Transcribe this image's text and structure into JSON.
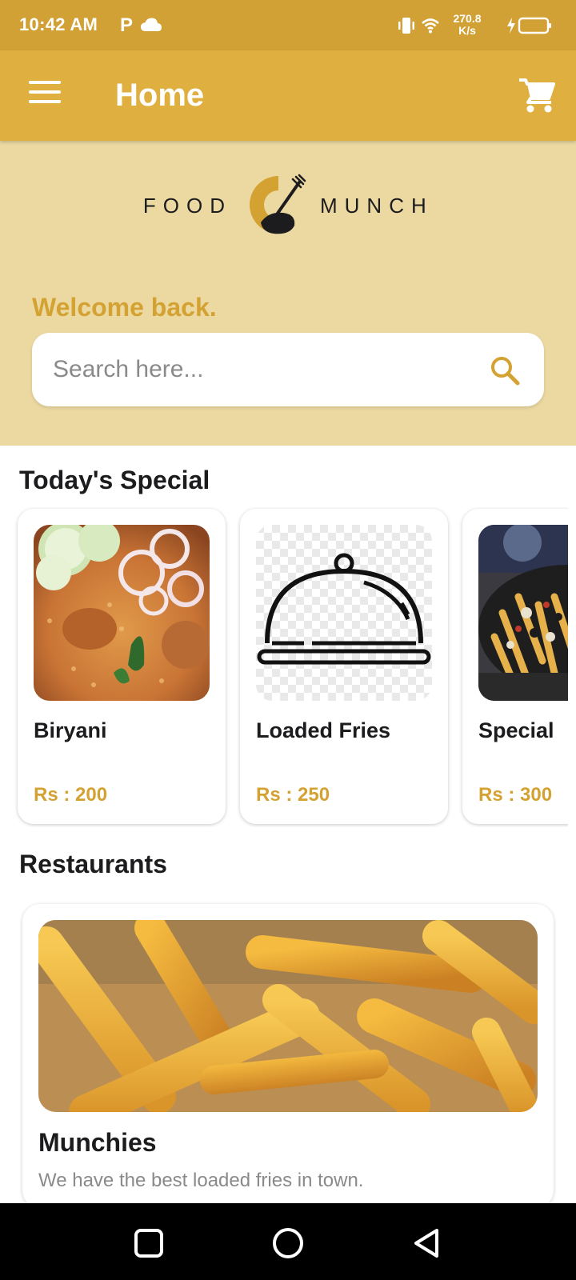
{
  "status_bar": {
    "time": "10:42 AM",
    "notification_letter": "P",
    "speed_value": "270.8",
    "speed_unit": "K/s"
  },
  "app_bar": {
    "title": "Home",
    "menu_icon": "hamburger-menu-icon",
    "cart_icon": "shopping-cart-icon"
  },
  "brand": {
    "left_word": "FOOD",
    "right_word": "MUNCH"
  },
  "hero": {
    "welcome": "Welcome back.",
    "search_placeholder": "Search here..."
  },
  "specials": {
    "title": "Today's Special",
    "items": [
      {
        "name": "Biryani",
        "price": "Rs : 200",
        "image": "biryani-photo"
      },
      {
        "name": "Loaded Fries",
        "price": "Rs : 250",
        "image": "cloche-icon"
      },
      {
        "name": "Special",
        "price": "Rs : 300",
        "image": "pizza-fries-photo"
      }
    ]
  },
  "restaurants": {
    "title": "Restaurants",
    "items": [
      {
        "name": "Munchies",
        "description": "We have the best loaded fries in town.",
        "image": "fries-photo"
      }
    ]
  },
  "nav_bar": {
    "icons": [
      "recents-square-icon",
      "home-circle-icon",
      "back-triangle-icon"
    ]
  },
  "colors": {
    "status_bar": "#d2a135",
    "app_bar": "#dfb03f",
    "hero_bg": "#ecd9a1",
    "accent": "#d4a233"
  }
}
